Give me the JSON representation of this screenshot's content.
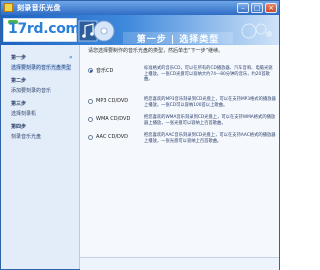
{
  "window": {
    "title": "刻录音乐光盘",
    "minimize_glyph": "–",
    "maximize_glyph": "□",
    "close_glyph": "×"
  },
  "banner": {
    "logo_text": "17rd.com",
    "step_title": "第一步 | 选择类型"
  },
  "sidebar": {
    "arrow_glyph": "»",
    "steps": [
      {
        "head": "第一步",
        "desc": "选择要刻录的音乐光盘类型"
      },
      {
        "head": "第二步",
        "desc": "添加要刻录的音乐"
      },
      {
        "head": "第三步",
        "desc": "选择刻录机"
      },
      {
        "head": "第四步",
        "desc": "刻录音乐光盘"
      }
    ]
  },
  "content": {
    "intro": "请您选择要制作的音乐光盘的类型，然后单击“下一步”继续。",
    "options": [
      {
        "label": "音乐CD",
        "desc": "标准格式的音乐CD，可以在所有的CD播放器、汽车音响、电脑光驱上播放。一张CD光盘可以容纳大约74—80分钟的音乐，约20首歌曲。"
      },
      {
        "label": "MP3 CD/DVD",
        "desc": "把您喜欢的MP3音乐刻录到CD光盘上，可以在支持MP3格式的播放器上播放，一张CD可以容纳100首以上歌曲。"
      },
      {
        "label": "WMA CD/DVD",
        "desc": "把您喜欢的WMA音乐刻录到CD光盘上，可以在支持WMA格式的播放器上播放，一张光盘可以容纳上百首歌曲。"
      },
      {
        "label": "AAC CD/DVD",
        "desc": "把您喜欢的AAC音乐刻录到CD光盘上，可以在支持AAC格式的播放器上播放，一张光盘可以容纳上百首歌曲。"
      }
    ],
    "selected_index": 0
  }
}
